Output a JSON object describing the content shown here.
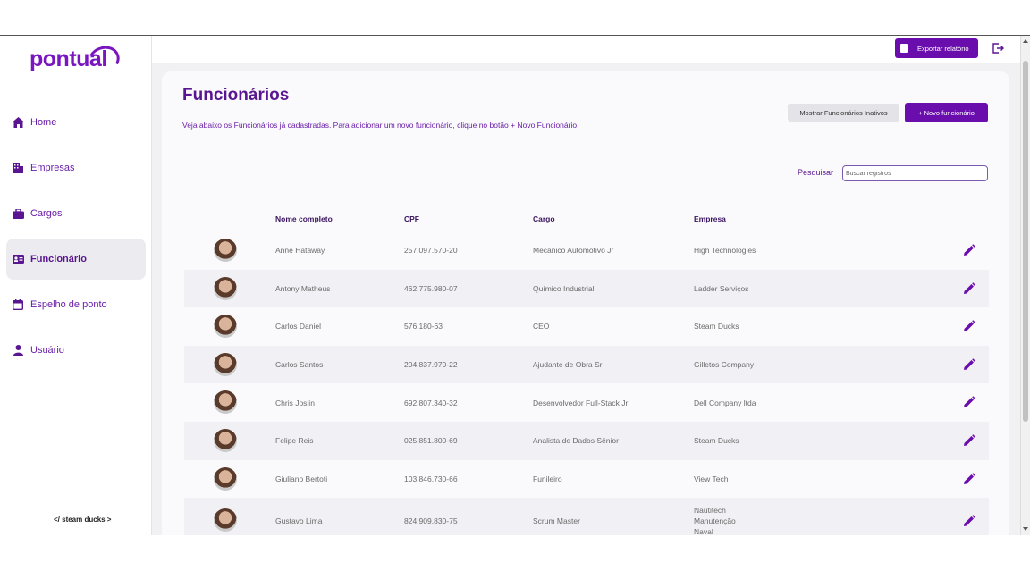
{
  "app": {
    "logo": "pontual",
    "footer_logo": "</ steam ducks >"
  },
  "sidebar": {
    "items": [
      {
        "label": "Home",
        "icon": "home-icon"
      },
      {
        "label": "Empresas",
        "icon": "building-icon"
      },
      {
        "label": "Cargos",
        "icon": "briefcase-icon"
      },
      {
        "label": "Funcionário",
        "icon": "id-card-icon",
        "active": true
      },
      {
        "label": "Espelho de ponto",
        "icon": "calendar-icon"
      },
      {
        "label": "Usuário",
        "icon": "user-icon"
      }
    ]
  },
  "topbar": {
    "export_label": "Exportar relatório"
  },
  "page": {
    "title": "Funcionários",
    "description": "Veja abaixo os Funcionários já cadastradas. Para adicionar um novo funcionário, clique no botão + Novo Funcionário.",
    "inactive_button": "Mostrar Funcionários Inativos",
    "new_button": "+ Novo funcionário",
    "search_label": "Pesquisar",
    "search_placeholder": "Buscar registros"
  },
  "table": {
    "headers": [
      "Nome completo",
      "CPF",
      "Cargo",
      "Empresa"
    ],
    "rows": [
      {
        "name": "Anne Hataway",
        "cpf": "257.097.570-20",
        "cargo": "Mecânico Automotivo Jr",
        "empresa": "High Technologies"
      },
      {
        "name": "Antony Matheus",
        "cpf": "462.775.980-07",
        "cargo": "Químico Industrial",
        "empresa": "Ladder Serviços"
      },
      {
        "name": "Carlos Daniel",
        "cpf": "576.180-63",
        "cargo": "CEO",
        "empresa": "Steam Ducks"
      },
      {
        "name": "Carlos Santos",
        "cpf": "204.837.970-22",
        "cargo": "Ajudante de Obra Sr",
        "empresa": "Gilletos Company"
      },
      {
        "name": "Chris Joslin",
        "cpf": "692.807.340-32",
        "cargo": "Desenvolvedor Full-Stack Jr",
        "empresa": "Dell Company ltda"
      },
      {
        "name": "Felipe Reis",
        "cpf": "025.851.800-69",
        "cargo": "Analista de Dados Sênior",
        "empresa": "Steam Ducks"
      },
      {
        "name": "Giuliano Bertoti",
        "cpf": "103.846.730-66",
        "cargo": "Funileiro",
        "empresa": "View Tech"
      },
      {
        "name": "Gustavo Lima",
        "cpf": "824.909.830-75",
        "cargo": "Scrum Master",
        "empresa": "Nautitech Manutenção Naval"
      }
    ]
  },
  "colors": {
    "accent": "#6a0dad",
    "title": "#5a1690"
  }
}
